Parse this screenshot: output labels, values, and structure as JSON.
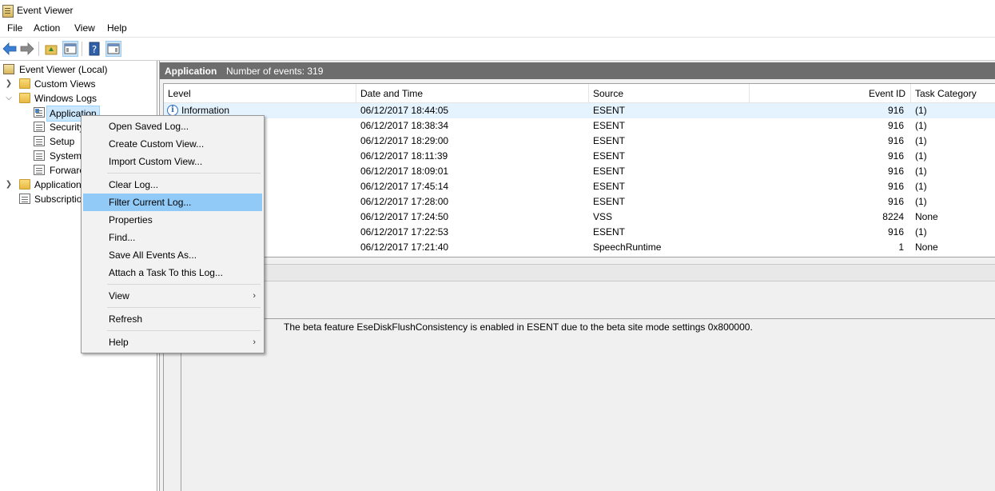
{
  "window": {
    "title": "Event Viewer"
  },
  "menu": [
    "File",
    "Action",
    "View",
    "Help"
  ],
  "tree": {
    "root": "Event Viewer (Local)",
    "custom_views": "Custom Views",
    "windows_logs": "Windows Logs",
    "logs": [
      "Application",
      "Security",
      "Setup",
      "System",
      "Forwarc"
    ],
    "app_services": "Application",
    "subscriptions": "Subscriptio"
  },
  "header": {
    "log_name": "Application",
    "count": "Number of events: 319"
  },
  "columns": [
    "Level",
    "Date and Time",
    "Source",
    "Event ID",
    "Task Category"
  ],
  "events": [
    {
      "level": "Information",
      "date": "06/12/2017 18:44:05",
      "source": "ESENT",
      "id": "916",
      "cat": "(1)"
    },
    {
      "level": "",
      "date": "06/12/2017 18:38:34",
      "source": "ESENT",
      "id": "916",
      "cat": "(1)"
    },
    {
      "level": "",
      "date": "06/12/2017 18:29:00",
      "source": "ESENT",
      "id": "916",
      "cat": "(1)"
    },
    {
      "level": "",
      "date": "06/12/2017 18:11:39",
      "source": "ESENT",
      "id": "916",
      "cat": "(1)"
    },
    {
      "level": "",
      "date": "06/12/2017 18:09:01",
      "source": "ESENT",
      "id": "916",
      "cat": "(1)"
    },
    {
      "level": "",
      "date": "06/12/2017 17:45:14",
      "source": "ESENT",
      "id": "916",
      "cat": "(1)"
    },
    {
      "level": "",
      "date": "06/12/2017 17:28:00",
      "source": "ESENT",
      "id": "916",
      "cat": "(1)"
    },
    {
      "level": "",
      "date": "06/12/2017 17:24:50",
      "source": "VSS",
      "id": "8224",
      "cat": "None"
    },
    {
      "level": "",
      "date": "06/12/2017 17:22:53",
      "source": "ESENT",
      "id": "916",
      "cat": "(1)"
    },
    {
      "level": "",
      "date": "06/12/2017 17:21:40",
      "source": "SpeechRuntime",
      "id": "1",
      "cat": "None"
    }
  ],
  "detail": {
    "message": "The beta feature EseDiskFlushConsistency is enabled in ESENT due to the beta site mode settings 0x800000."
  },
  "context_menu": {
    "open_saved": "Open Saved Log...",
    "create_custom": "Create Custom View...",
    "import_custom": "Import Custom View...",
    "clear_log": "Clear Log...",
    "filter_log": "Filter Current Log...",
    "properties": "Properties",
    "find": "Find...",
    "save_all": "Save All Events As...",
    "attach_task": "Attach a Task To this Log...",
    "view": "View",
    "refresh": "Refresh",
    "help": "Help"
  }
}
